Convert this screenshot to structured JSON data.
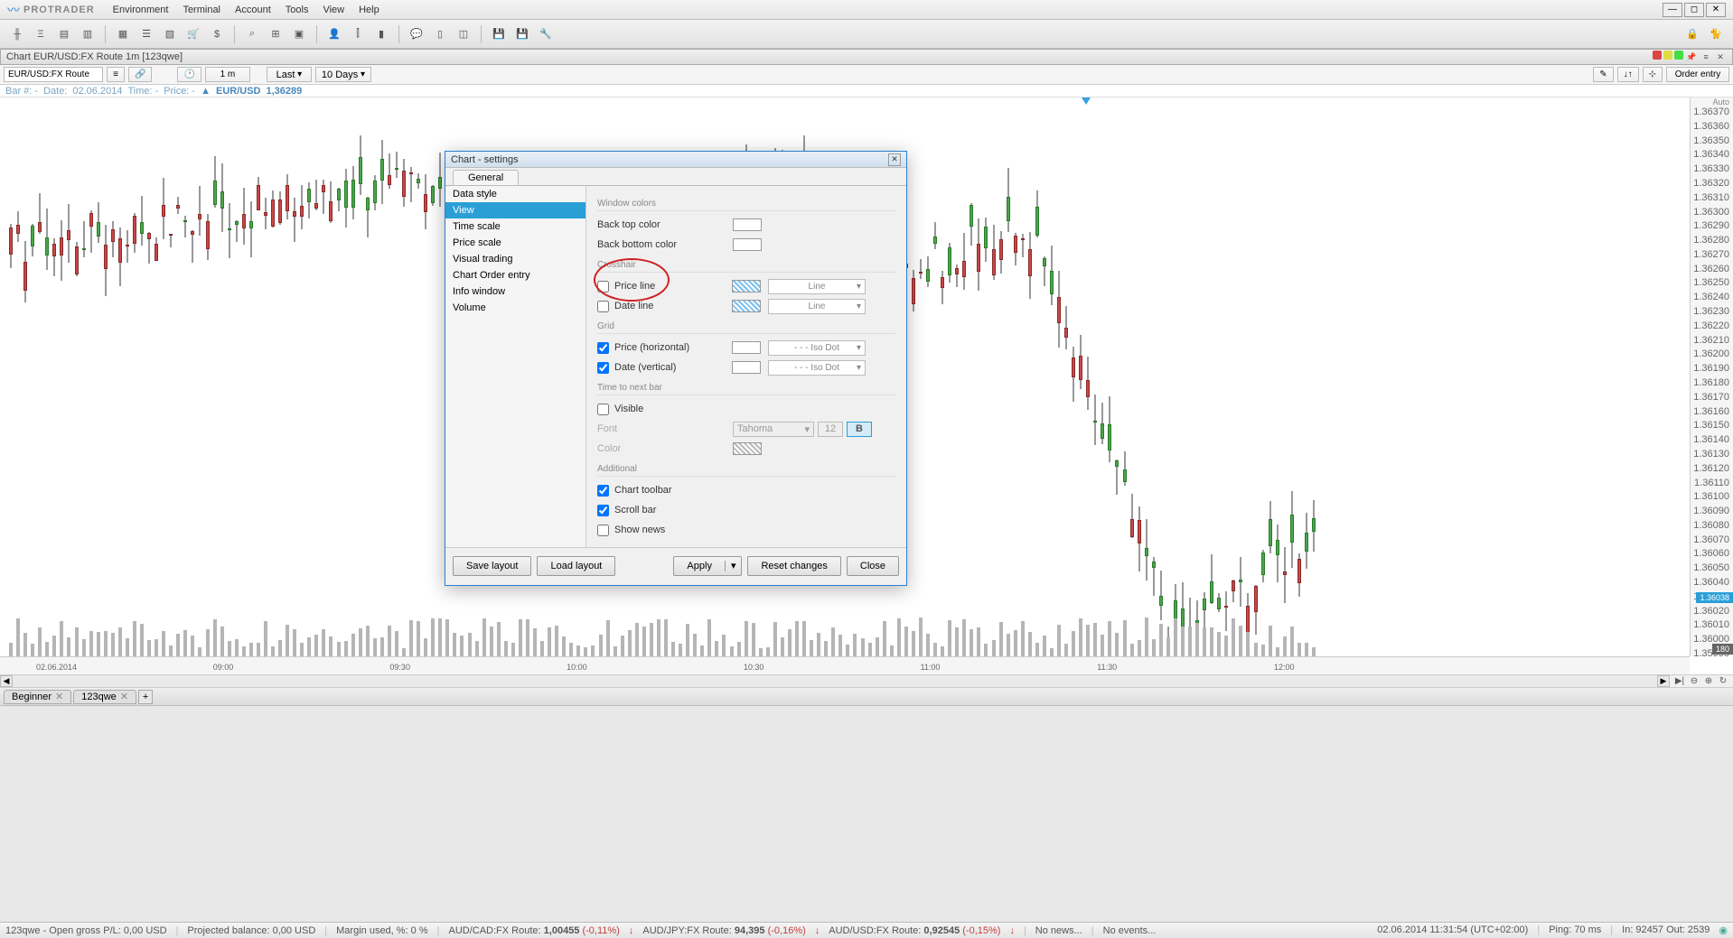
{
  "app": {
    "name": "PROTRADER"
  },
  "menu": [
    "Environment",
    "Terminal",
    "Account",
    "Tools",
    "View",
    "Help"
  ],
  "panel": {
    "title": "Chart EUR/USD:FX Route 1m [123qwe]"
  },
  "chart_toolbar": {
    "symbol": "EUR/USD:FX Route",
    "timeframe": "1 m",
    "agg": "Last",
    "range": "10 Days",
    "order_entry": "Order entry"
  },
  "info": {
    "bar": "Bar #: -",
    "date_lbl": "Date:",
    "date": "02.06.2014",
    "time_lbl": "Time: -",
    "price_lbl": "Price: -",
    "pair": "EUR/USD",
    "price": "1,36289"
  },
  "y_axis": {
    "auto": "Auto",
    "ticks": [
      "1.36370",
      "1.36360",
      "1.36350",
      "1.36340",
      "1.36330",
      "1.36320",
      "1.36310",
      "1.36300",
      "1.36290",
      "1.36280",
      "1.36270",
      "1.36260",
      "1.36250",
      "1.36240",
      "1.36230",
      "1.36220",
      "1.36210",
      "1.36200",
      "1.36190",
      "1.36180",
      "1.36170",
      "1.36160",
      "1.36150",
      "1.36140",
      "1.36130",
      "1.36120",
      "1.36110",
      "1.36100",
      "1.36090",
      "1.36080",
      "1.36070",
      "1.36060",
      "1.36050",
      "1.36040",
      "1.36030",
      "1.36020",
      "1.36010",
      "1.36000",
      "1.35990"
    ],
    "price_tag": "1.36038",
    "vol_tag": "180"
  },
  "x_axis": [
    "02.06.2014",
    "09:00",
    "09:30",
    "10:00",
    "10:30",
    "11:00",
    "11:30",
    "12:00"
  ],
  "dialog": {
    "title": "Chart - settings",
    "tab": "General",
    "sidebar": [
      "Data style",
      "View",
      "Time scale",
      "Price scale",
      "Visual trading",
      "Chart Order entry",
      "Info window",
      "Volume"
    ],
    "active_side": 1,
    "sections": {
      "window_colors": "Window colors",
      "back_top": "Back top color",
      "back_bottom": "Back bottom color",
      "crosshair": "Crosshair",
      "price_line": "Price line",
      "date_line": "Date line",
      "grid": "Grid",
      "price_h": "Price (horizontal)",
      "date_v": "Date (vertical)",
      "time_next": "Time to next bar",
      "visible": "Visible",
      "font": "Font",
      "font_name": "Tahoma",
      "font_size": "12",
      "font_style": "B",
      "color": "Color",
      "additional": "Additional",
      "chart_toolbar": "Chart toolbar",
      "scroll_bar": "Scroll bar",
      "show_news": "Show news",
      "line": "Line",
      "iso_dot": "- - -   Iso Dot"
    },
    "buttons": {
      "save": "Save layout",
      "load": "Load layout",
      "apply": "Apply",
      "reset": "Reset changes",
      "close": "Close"
    }
  },
  "bottom_tabs": {
    "tab1": "Beginner",
    "tab2": "123qwe"
  },
  "status": {
    "s1": "123qwe - Open gross  P/L: 0,00 USD",
    "s2": "Projected balance: 0,00 USD",
    "s3": "Margin used, %: 0 %",
    "s4_lbl": "AUD/CAD:FX Route:",
    "s4_val": "1,00455",
    "s4_pct": "(-0,11%)",
    "s5_lbl": "AUD/JPY:FX Route:",
    "s5_val": "94,395",
    "s5_pct": "(-0,16%)",
    "s6_lbl": "AUD/USD:FX Route:",
    "s6_val": "0,92545",
    "s6_pct": "(-0,15%)",
    "news": "No news...",
    "events": "No events...",
    "datetime": "02.06.2014  11:31:54 (UTC+02:00)",
    "ping": "Ping: 70 ms",
    "io": "In: 92457 Out: 2539"
  },
  "chart_data": {
    "type": "candlestick",
    "series_count": 1,
    "price_range": [
      1.3599,
      1.3637
    ],
    "current_price": 1.36038,
    "note": "Candlestick OHLC approximated from pixels; ~180 bars, 1-minute EUR/USD"
  }
}
